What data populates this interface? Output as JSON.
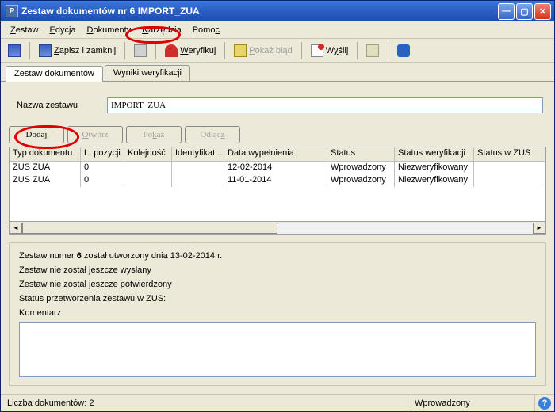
{
  "title": "Zestaw dokumentów nr 6 IMPORT_ZUA",
  "menubar": {
    "zestaw": "Zestaw",
    "edycja": "Edycja",
    "dokumenty": "Dokumenty",
    "narzedzia": "Narzędzia",
    "pomoc": "Pomoc"
  },
  "toolbar": {
    "save_close": "Zapisz i zamknij",
    "verify": "Weryfikuj",
    "show_error": "Pokaż błąd",
    "send": "Wyślij"
  },
  "tabs": {
    "docs": "Zestaw dokumentów",
    "verify": "Wyniki weryfikacji"
  },
  "name_label": "Nazwa zestawu",
  "name_value": "IMPORT_ZUA",
  "buttons": {
    "add": "Dodaj",
    "open": "Otwórz",
    "show": "Pokaż",
    "detach": "Odłącz"
  },
  "grid": {
    "headers": {
      "typ": "Typ dokumentu",
      "lp": "L. pozycji",
      "kol": "Kolejność",
      "id": "Identyfikat...",
      "data": "Data wypełnienia",
      "status": "Status",
      "sw": "Status weryfikacji",
      "sz": "Status w ZUS"
    },
    "rows": [
      {
        "typ": "ZUS ZUA",
        "lp": "0",
        "kol": "",
        "id": "",
        "data": "12-02-2014",
        "status": "Wprowadzony",
        "sw": "Niezweryfikowany",
        "sz": ""
      },
      {
        "typ": "ZUS ZUA",
        "lp": "0",
        "kol": "",
        "id": "",
        "data": "11-01-2014",
        "status": "Wprowadzony",
        "sw": "Niezweryfikowany",
        "sz": ""
      }
    ]
  },
  "info": {
    "line1_pre": "Zestaw numer ",
    "line1_num": "6",
    "line1_post": " został utworzony dnia 13-02-2014 r.",
    "line2": "Zestaw nie został jeszcze wysłany",
    "line3": "Zestaw nie został jeszcze potwierdzony",
    "line4": "Status przetworzenia zestawu w ZUS:",
    "comment_label": "Komentarz",
    "comment_value": ""
  },
  "statusbar": {
    "count": "Liczba dokumentów: 2",
    "status": "Wprowadzony"
  }
}
